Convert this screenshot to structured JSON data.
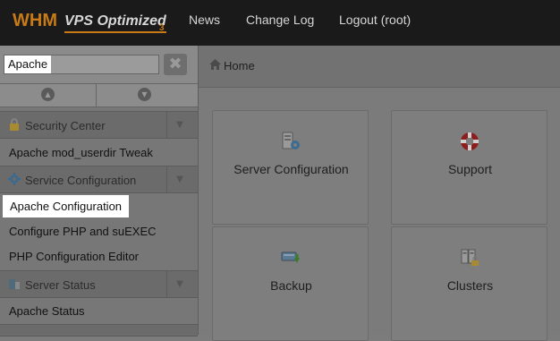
{
  "header": {
    "logo_main": "WHM",
    "logo_product": "VPS Optimized",
    "logo_version": "3",
    "nav": [
      "News",
      "Change Log",
      "Logout (root)"
    ]
  },
  "sidebar": {
    "search_value": "Apache",
    "clear_symbol": "✖",
    "sections": [
      {
        "label": "Security Center",
        "icon": "lock-icon"
      },
      {
        "label": "Service Configuration",
        "icon": "gear-icon"
      },
      {
        "label": "Server Status",
        "icon": "server-status-icon"
      }
    ],
    "items": [
      "Apache mod_userdir Tweak",
      "Apache Configuration",
      "Configure PHP and suEXEC",
      "PHP Configuration Editor",
      "Apache Status"
    ]
  },
  "breadcrumb": {
    "home": "Home"
  },
  "tiles": [
    {
      "label": "Server Configuration",
      "icon": "server-config-icon"
    },
    {
      "label": "Support",
      "icon": "life-ring-icon"
    },
    {
      "label": "Backup",
      "icon": "backup-icon"
    },
    {
      "label": "Clusters",
      "icon": "clusters-icon"
    }
  ],
  "colors": {
    "accent": "#c77a16",
    "topbar": "#1a1a1a",
    "overlay_gray": "#7b7b7b"
  }
}
